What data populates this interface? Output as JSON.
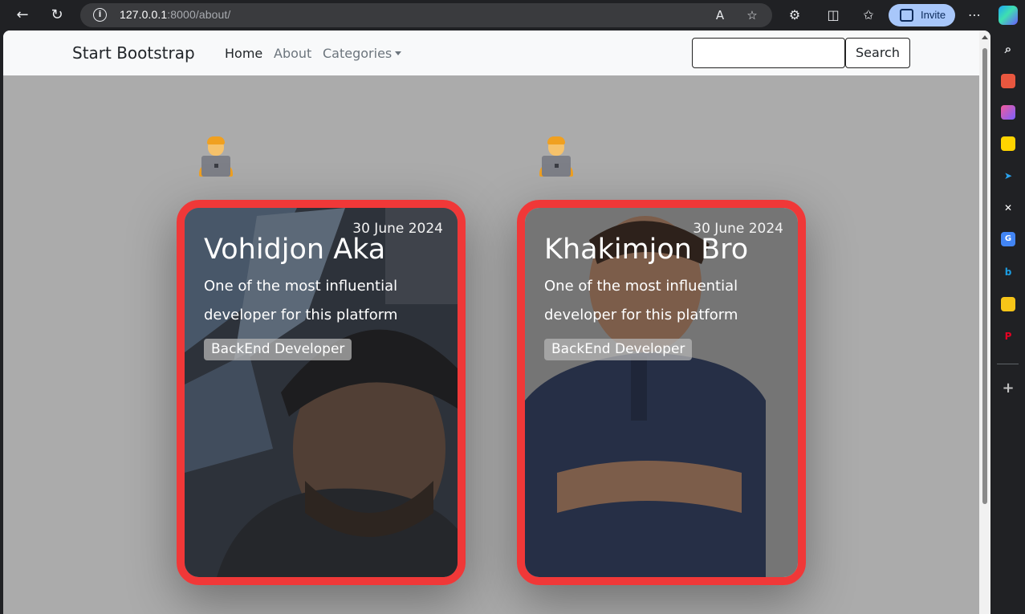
{
  "browser": {
    "url_host": "127.0.0.1",
    "url_path": ":8000/about/",
    "invite_label": "Invite"
  },
  "navbar": {
    "brand": "Start Bootstrap",
    "links": [
      {
        "label": "Home"
      },
      {
        "label": "About"
      },
      {
        "label": "Categories"
      }
    ],
    "search_value": "",
    "search_button": "Search"
  },
  "cards": [
    {
      "date": "30 June 2024",
      "name": "Vohidjon Aka",
      "description": "One of the most influential developer for this platform",
      "role": "BackEnd Developer",
      "avatar_icon": "technologist-emoji"
    },
    {
      "date": "30 June 2024",
      "name": "Khakimjon Bro",
      "description": "One of the most influential developer for this platform",
      "role": "BackEnd Developer",
      "avatar_icon": "technologist-emoji"
    }
  ],
  "colors": {
    "card_border": "#f03838",
    "page_background": "#ababab",
    "navbar_background": "#f8f9fa",
    "invite_button": "#a8c7fa"
  }
}
